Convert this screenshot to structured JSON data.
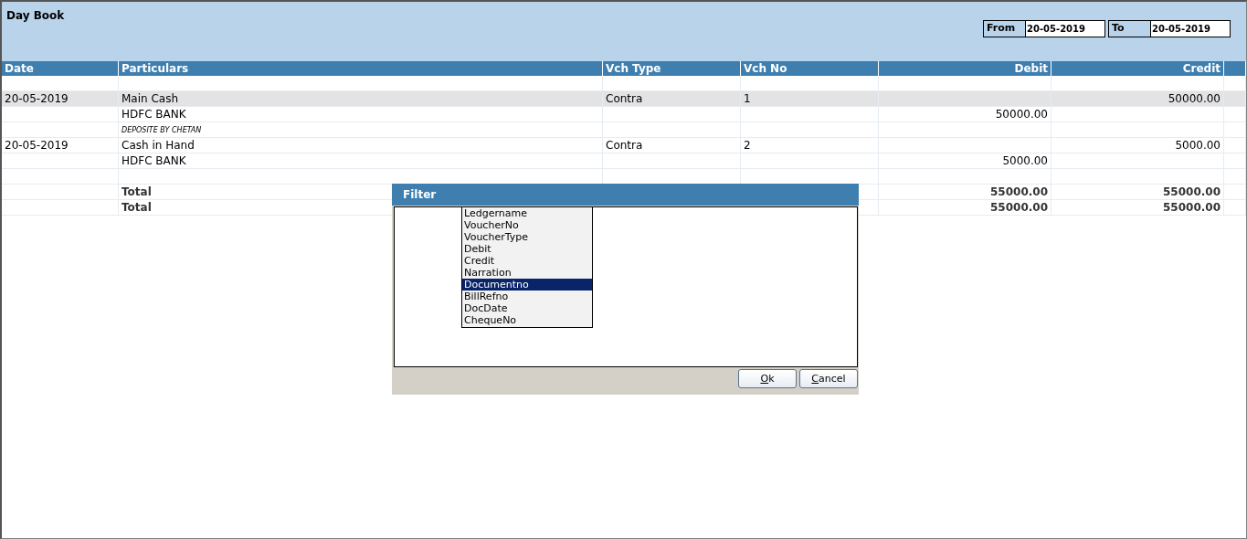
{
  "window": {
    "title": "Day Book"
  },
  "date_range": {
    "from_label": "From",
    "from_value": "20-05-2019",
    "to_label": "To",
    "to_value": "20-05-2019"
  },
  "table": {
    "columns": [
      "Date",
      "Particulars",
      "Vch Type",
      "Vch No",
      "Debit",
      "Credit"
    ],
    "rows": [
      {
        "kind": "blank",
        "selected": false
      },
      {
        "kind": "entry",
        "selected": true,
        "date": "20-05-2019",
        "particulars": "Main Cash",
        "vch_type": "Contra",
        "vch_no": "1",
        "credit": "50000.00"
      },
      {
        "kind": "entry",
        "selected": false,
        "particulars": "HDFC BANK",
        "debit": "50000.00"
      },
      {
        "kind": "narration",
        "selected": false,
        "particulars": "DEPOSITE BY CHETAN"
      },
      {
        "kind": "entry",
        "selected": false,
        "date": "20-05-2019",
        "particulars": "Cash in Hand",
        "vch_type": "Contra",
        "vch_no": "2",
        "credit": "5000.00"
      },
      {
        "kind": "entry",
        "selected": false,
        "particulars": "HDFC BANK",
        "debit": "5000.00"
      },
      {
        "kind": "blank",
        "selected": false
      },
      {
        "kind": "total",
        "selected": false,
        "particulars": "Total",
        "debit": "55000.00",
        "credit": "55000.00"
      },
      {
        "kind": "total",
        "selected": false,
        "particulars": "Total",
        "debit": "55000.00",
        "credit": "55000.00"
      }
    ]
  },
  "filter_dialog": {
    "title": "Filter",
    "fields": [
      {
        "label": "Ledgername",
        "selected": false
      },
      {
        "label": "VoucherNo",
        "selected": false
      },
      {
        "label": "VoucherType",
        "selected": false
      },
      {
        "label": "Debit",
        "selected": false
      },
      {
        "label": "Credit",
        "selected": false
      },
      {
        "label": "Narration",
        "selected": false
      },
      {
        "label": "Documentno",
        "selected": true
      },
      {
        "label": "BillRefno",
        "selected": false
      },
      {
        "label": "DocDate",
        "selected": false
      },
      {
        "label": "ChequeNo",
        "selected": false
      }
    ],
    "buttons": [
      "Ok",
      "Cancel"
    ]
  }
}
